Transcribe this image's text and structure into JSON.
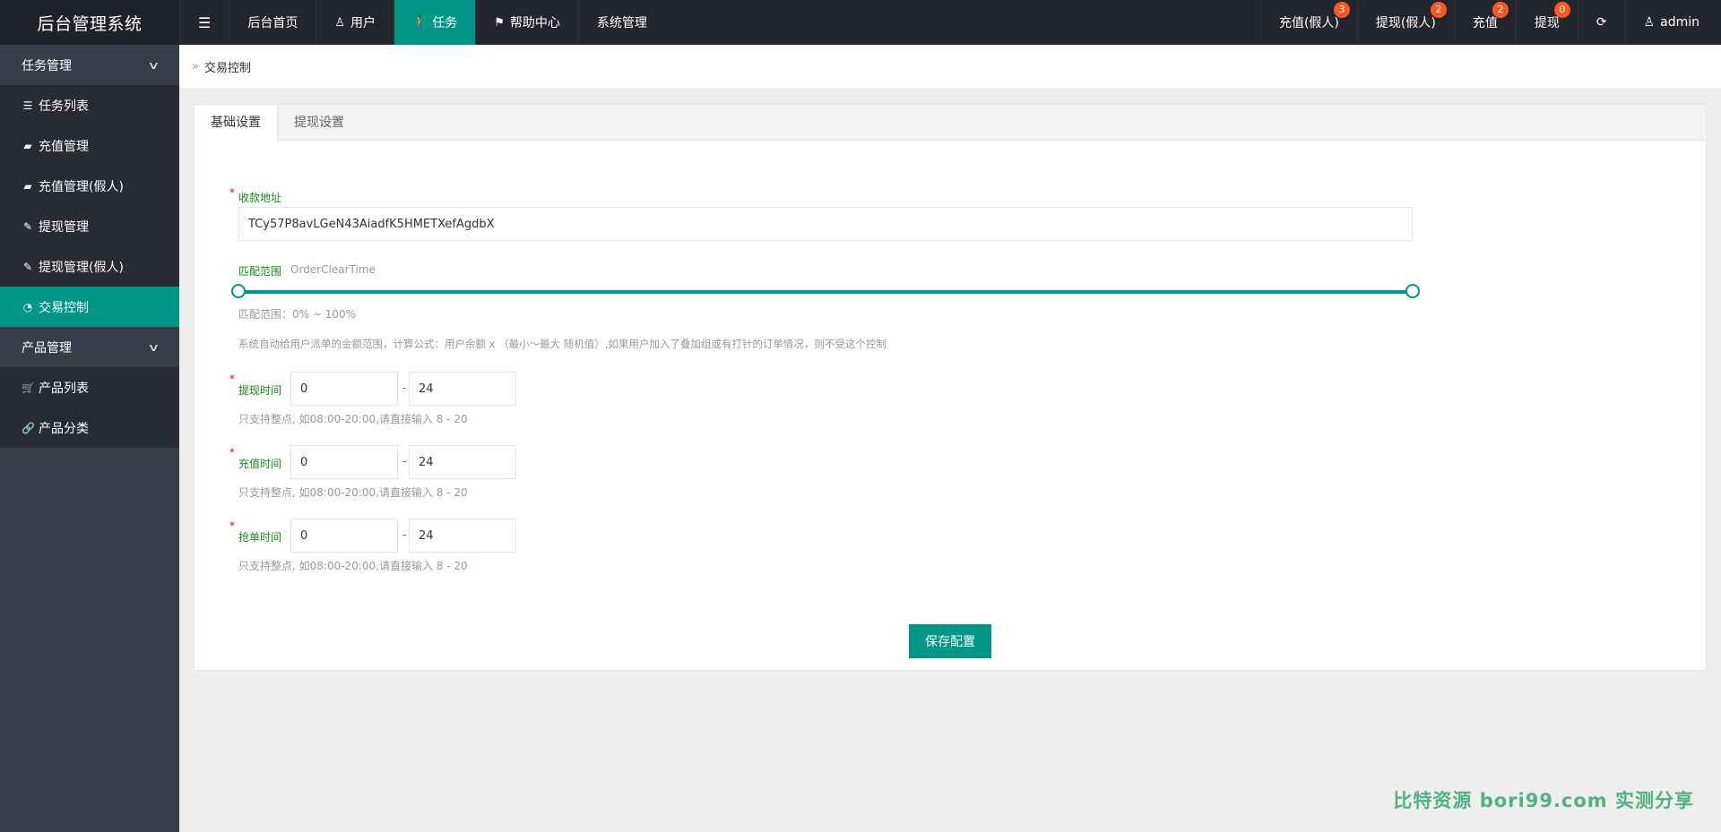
{
  "app": {
    "title": "后台管理系统"
  },
  "topnav": {
    "toggle_icon": "menu-toggle-icon",
    "items": [
      {
        "label": "后台首页"
      },
      {
        "label": "用户",
        "icon": "user-icon"
      },
      {
        "label": "任务",
        "icon": "walker-icon",
        "active": true
      },
      {
        "label": "帮助中心",
        "icon": "flag-icon"
      },
      {
        "label": "系统管理"
      }
    ]
  },
  "topright": {
    "items": [
      {
        "label": "充值(假人)",
        "badge": "3"
      },
      {
        "label": "提现(假人)",
        "badge": "2"
      },
      {
        "label": "充值",
        "badge": "2"
      },
      {
        "label": "提现",
        "badge": "0"
      }
    ],
    "refresh_icon": "refresh-icon",
    "user": "admin"
  },
  "sidebar": {
    "groups": [
      {
        "label": "任务管理",
        "items": [
          {
            "label": "任务列表",
            "icon": "list-icon"
          },
          {
            "label": "充值管理",
            "icon": "chat-icon"
          },
          {
            "label": "充值管理(假人)",
            "icon": "chat-icon"
          },
          {
            "label": "提现管理",
            "icon": "gavel-icon"
          },
          {
            "label": "提现管理(假人)",
            "icon": "gavel-icon"
          },
          {
            "label": "交易控制",
            "icon": "dashboard-icon",
            "active": true
          }
        ]
      },
      {
        "label": "产品管理",
        "items": [
          {
            "label": "产品列表",
            "icon": "cart-icon"
          },
          {
            "label": "产品分类",
            "icon": "link-icon"
          }
        ]
      }
    ]
  },
  "breadcrumb": {
    "current": "交易控制"
  },
  "tabs": [
    {
      "label": "基础设置",
      "active": true
    },
    {
      "label": "提现设置"
    }
  ],
  "form": {
    "address": {
      "label": "收款地址",
      "value": "TCy57P8avLGeN43AiadfK5HMETXefAgdbX"
    },
    "match": {
      "label": "匹配范围",
      "sublabel": "OrderClearTime",
      "range_min": 0,
      "range_max": 100,
      "range_text": "匹配范围：0% ~ 100%",
      "description": "系统自动给用户派单的金额范围，计算公式：用户余额 x （最小～最大 随机值）,如果用户加入了叠加组或有打针的订单情况，则不受这个控制"
    },
    "withdraw_time": {
      "label": "提现时间",
      "from": "0",
      "to": "24",
      "hint": "只支持整点, 如08:00-20:00,请直接输入 8 - 20"
    },
    "recharge_time": {
      "label": "充值时间",
      "from": "0",
      "to": "24",
      "hint": "只支持整点, 如08:00-20:00,请直接输入 8 - 20"
    },
    "grab_time": {
      "label": "抢单时间",
      "from": "0",
      "to": "24",
      "hint": "只支持整点, 如08:00-20:00,请直接输入 8 - 20"
    },
    "separator": "-",
    "required_mark": "*",
    "save_label": "保存配置"
  },
  "watermark": "比特资源 bori99.com 实测分享",
  "colors": {
    "accent": "#009688",
    "header": "#23262e",
    "sidebar": "#393d49",
    "badge": "#ff5722"
  }
}
